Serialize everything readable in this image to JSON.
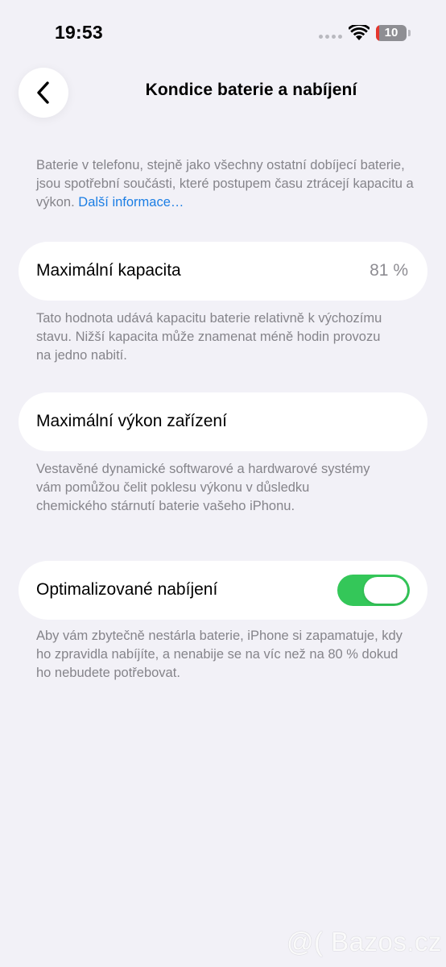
{
  "status_bar": {
    "time": "19:53",
    "battery_level": "10",
    "battery_color": "#e5352d"
  },
  "nav": {
    "back_icon": "chevron-left-icon",
    "title": "Kondice baterie a nabíjení"
  },
  "intro": {
    "text": "Baterie v telefonu, stejně jako všechny ostatní dobíjecí baterie, jsou spotřební součásti, které postupem času ztrácejí kapacitu a výkon. ",
    "link": "Další informace…",
    "link_color": "#1c7ee4"
  },
  "max_capacity": {
    "label": "Maximální kapacita",
    "value": "81 %",
    "footnote": "Tato hodnota udává kapacitu baterie relativně k výchozímu stavu. Nižší kapacita může znamenat méně hodin provozu na jedno nabití."
  },
  "peak_performance": {
    "label": "Maximální výkon zařízení",
    "footnote": "Vestavěné dynamické softwarové a hardwarové systémy vám pomůžou čelit poklesu výkonu v důsledku chemického stárnutí baterie vašeho iPhonu."
  },
  "optimized_charging": {
    "label": "Optimalizované nabíjení",
    "enabled": true,
    "toggle_color": "#34c759",
    "footnote": "Aby vám zbytečně nestárla baterie, iPhone si zapamatuje, kdy ho zpravidla nabíjíte, a nenabije se na víc než na 80 % dokud ho nebudete potřebovat."
  },
  "watermark": "@( Bazos.cz"
}
